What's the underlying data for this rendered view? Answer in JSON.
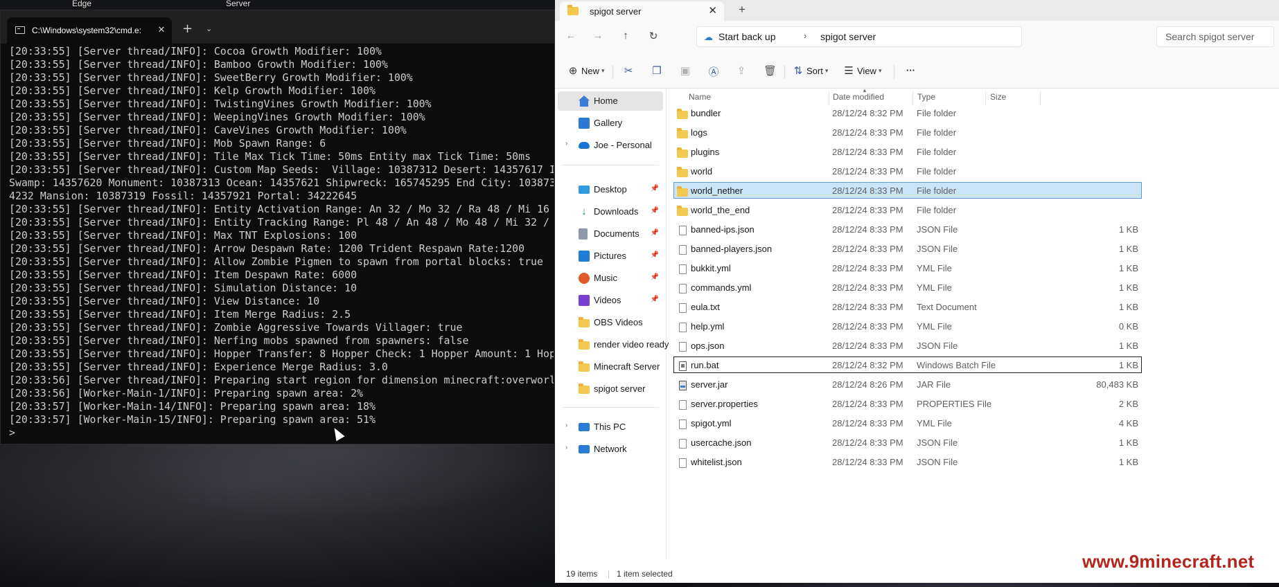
{
  "desktop": {
    "labels": [
      "Edge",
      "Server"
    ]
  },
  "terminal": {
    "tab_title": "C:\\Windows\\system32\\cmd.e:",
    "lines": [
      "[20:33:55] [Server thread/INFO]: Cocoa Growth Modifier: 100%",
      "[20:33:55] [Server thread/INFO]: Bamboo Growth Modifier: 100%",
      "[20:33:55] [Server thread/INFO]: SweetBerry Growth Modifier: 100%",
      "[20:33:55] [Server thread/INFO]: Kelp Growth Modifier: 100%",
      "[20:33:55] [Server thread/INFO]: TwistingVines Growth Modifier: 100%",
      "[20:33:55] [Server thread/INFO]: WeepingVines Growth Modifier: 100%",
      "[20:33:55] [Server thread/INFO]: CaveVines Growth Modifier: 100%",
      "[20:33:55] [Server thread/INFO]: Mob Spawn Range: 6",
      "[20:33:55] [Server thread/INFO]: Tile Max Tick Time: 50ms Entity max Tick Time: 50ms",
      "[20:33:55] [Server thread/INFO]: Custom Map Seeds:  Village: 10387312 Desert: 14357617 I",
      "Swamp: 14357620 Monument: 10387313 Ocean: 14357621 Shipwreck: 165745295 End City: 103873",
      "4232 Mansion: 10387319 Fossil: 14357921 Portal: 34222645",
      "[20:33:55] [Server thread/INFO]: Entity Activation Range: An 32 / Mo 32 / Ra 48 / Mi 16",
      "[20:33:55] [Server thread/INFO]: Entity Tracking Range: Pl 48 / An 48 / Mo 48 / Mi 32 /",
      "[20:33:55] [Server thread/INFO]: Max TNT Explosions: 100",
      "[20:33:55] [Server thread/INFO]: Arrow Despawn Rate: 1200 Trident Respawn Rate:1200",
      "[20:33:55] [Server thread/INFO]: Allow Zombie Pigmen to spawn from portal blocks: true",
      "[20:33:55] [Server thread/INFO]: Item Despawn Rate: 6000",
      "[20:33:55] [Server thread/INFO]: Simulation Distance: 10",
      "[20:33:55] [Server thread/INFO]: View Distance: 10",
      "[20:33:55] [Server thread/INFO]: Item Merge Radius: 2.5",
      "[20:33:55] [Server thread/INFO]: Zombie Aggressive Towards Villager: true",
      "[20:33:55] [Server thread/INFO]: Nerfing mobs spawned from spawners: false",
      "[20:33:55] [Server thread/INFO]: Hopper Transfer: 8 Hopper Check: 1 Hopper Amount: 1 Hop",
      "[20:33:55] [Server thread/INFO]: Experience Merge Radius: 3.0",
      "[20:33:56] [Server thread/INFO]: Preparing start region for dimension minecraft:overworl",
      "[20:33:56] [Worker-Main-1/INFO]: Preparing spawn area: 2%",
      "[20:33:57] [Worker-Main-14/INFO]: Preparing spawn area: 18%",
      "[20:33:57] [Worker-Main-15/INFO]: Preparing spawn area: 51%",
      ">"
    ]
  },
  "explorer": {
    "tab_title": "spigot server",
    "address": {
      "crumb1": "Start back up",
      "crumb2": "spigot server",
      "search_placeholder": "Search spigot server"
    },
    "toolbar": {
      "new": "New",
      "sort": "Sort",
      "view": "View",
      "more": "···"
    },
    "sidebar": {
      "home": "Home",
      "gallery": "Gallery",
      "onedrive": "Joe - Personal",
      "desktop": "Desktop",
      "downloads": "Downloads",
      "documents": "Documents",
      "pictures": "Pictures",
      "music": "Music",
      "videos": "Videos",
      "obs": "OBS Videos",
      "render": "render video ready",
      "minecraft": "Minecraft Server",
      "spigot": "spigot server",
      "thispc": "This PC",
      "network": "Network"
    },
    "columns": {
      "name": "Name",
      "date": "Date modified",
      "type": "Type",
      "size": "Size"
    },
    "files": [
      {
        "name": "bundler",
        "date": "28/12/24 8:32 PM",
        "type": "File folder",
        "size": "",
        "icon": "folder"
      },
      {
        "name": "logs",
        "date": "28/12/24 8:33 PM",
        "type": "File folder",
        "size": "",
        "icon": "folder"
      },
      {
        "name": "plugins",
        "date": "28/12/24 8:33 PM",
        "type": "File folder",
        "size": "",
        "icon": "folder"
      },
      {
        "name": "world",
        "date": "28/12/24 8:33 PM",
        "type": "File folder",
        "size": "",
        "icon": "folder"
      },
      {
        "name": "world_nether",
        "date": "28/12/24 8:33 PM",
        "type": "File folder",
        "size": "",
        "icon": "folder"
      },
      {
        "name": "world_the_end",
        "date": "28/12/24 8:33 PM",
        "type": "File folder",
        "size": "",
        "icon": "folder"
      },
      {
        "name": "banned-ips.json",
        "date": "28/12/24 8:33 PM",
        "type": "JSON File",
        "size": "1 KB",
        "icon": "file"
      },
      {
        "name": "banned-players.json",
        "date": "28/12/24 8:33 PM",
        "type": "JSON File",
        "size": "1 KB",
        "icon": "file"
      },
      {
        "name": "bukkit.yml",
        "date": "28/12/24 8:33 PM",
        "type": "YML File",
        "size": "1 KB",
        "icon": "file"
      },
      {
        "name": "commands.yml",
        "date": "28/12/24 8:33 PM",
        "type": "YML File",
        "size": "1 KB",
        "icon": "file"
      },
      {
        "name": "eula.txt",
        "date": "28/12/24 8:33 PM",
        "type": "Text Document",
        "size": "1 KB",
        "icon": "file"
      },
      {
        "name": "help.yml",
        "date": "28/12/24 8:33 PM",
        "type": "YML File",
        "size": "0 KB",
        "icon": "file"
      },
      {
        "name": "ops.json",
        "date": "28/12/24 8:33 PM",
        "type": "JSON File",
        "size": "1 KB",
        "icon": "file"
      },
      {
        "name": "run.bat",
        "date": "28/12/24 8:32 PM",
        "type": "Windows Batch File",
        "size": "1 KB",
        "icon": "bat"
      },
      {
        "name": "server.jar",
        "date": "28/12/24 8:26 PM",
        "type": "JAR File",
        "size": "80,483 KB",
        "icon": "jar"
      },
      {
        "name": "server.properties",
        "date": "28/12/24 8:33 PM",
        "type": "PROPERTIES File",
        "size": "2 KB",
        "icon": "file"
      },
      {
        "name": "spigot.yml",
        "date": "28/12/24 8:33 PM",
        "type": "YML File",
        "size": "4 KB",
        "icon": "file"
      },
      {
        "name": "usercache.json",
        "date": "28/12/24 8:33 PM",
        "type": "JSON File",
        "size": "1 KB",
        "icon": "file"
      },
      {
        "name": "whitelist.json",
        "date": "28/12/24 8:33 PM",
        "type": "JSON File",
        "size": "1 KB",
        "icon": "file"
      }
    ],
    "selected_item": "world_nether",
    "focused_item": "run.bat",
    "status": {
      "items": "19 items",
      "selected": "1 item selected"
    }
  },
  "watermark": "www.9minecraft.net",
  "colors": {
    "selection_bg": "#cce4f7",
    "selection_border": "#5b9bd5",
    "folder": "#f2c94c",
    "watermark": "#b3261e"
  }
}
